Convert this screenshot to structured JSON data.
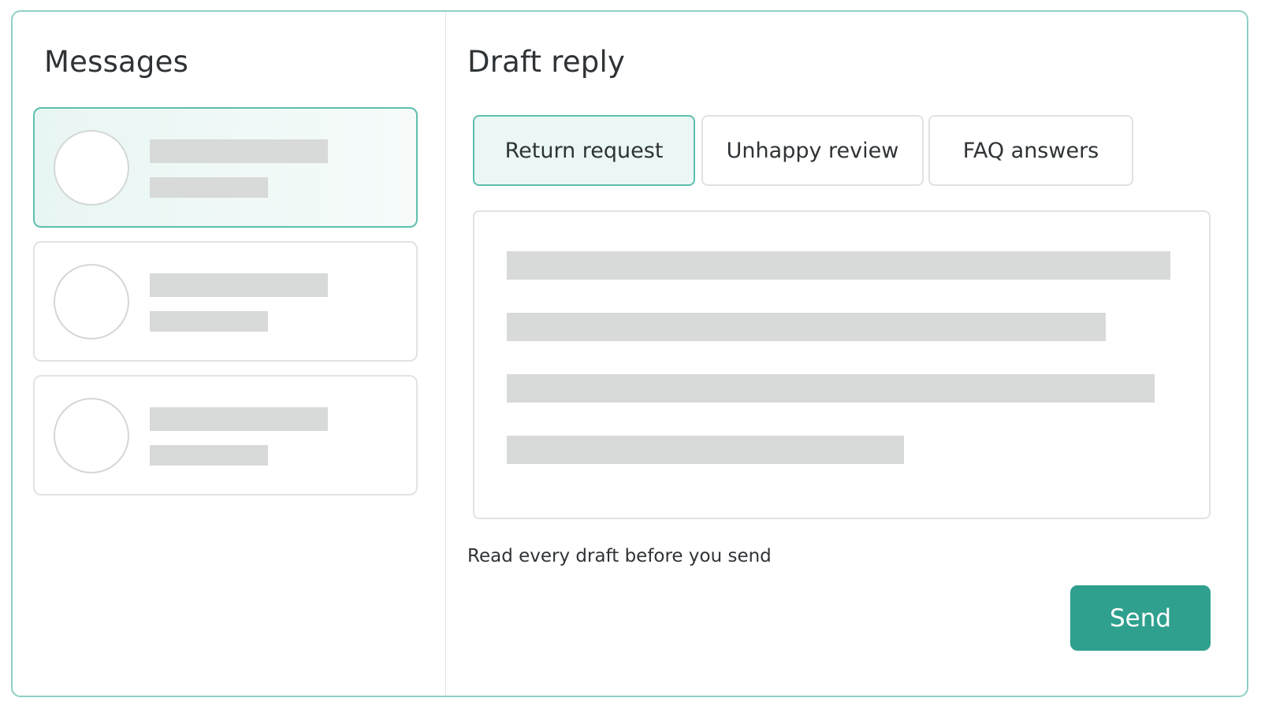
{
  "messages": {
    "title": "Messages"
  },
  "draft": {
    "title": "Draft reply",
    "tabs": [
      {
        "label": "Return request",
        "active": true
      },
      {
        "label": "Unhappy review",
        "active": false
      },
      {
        "label": "FAQ answers",
        "active": false
      }
    ],
    "hint": "Read every draft before you send",
    "send_label": "Send"
  },
  "colors": {
    "accent": "#2fa08e",
    "accent_border": "#5dbfae",
    "active_background": "#eaf7f4",
    "placeholder": "#d8d9d9"
  }
}
